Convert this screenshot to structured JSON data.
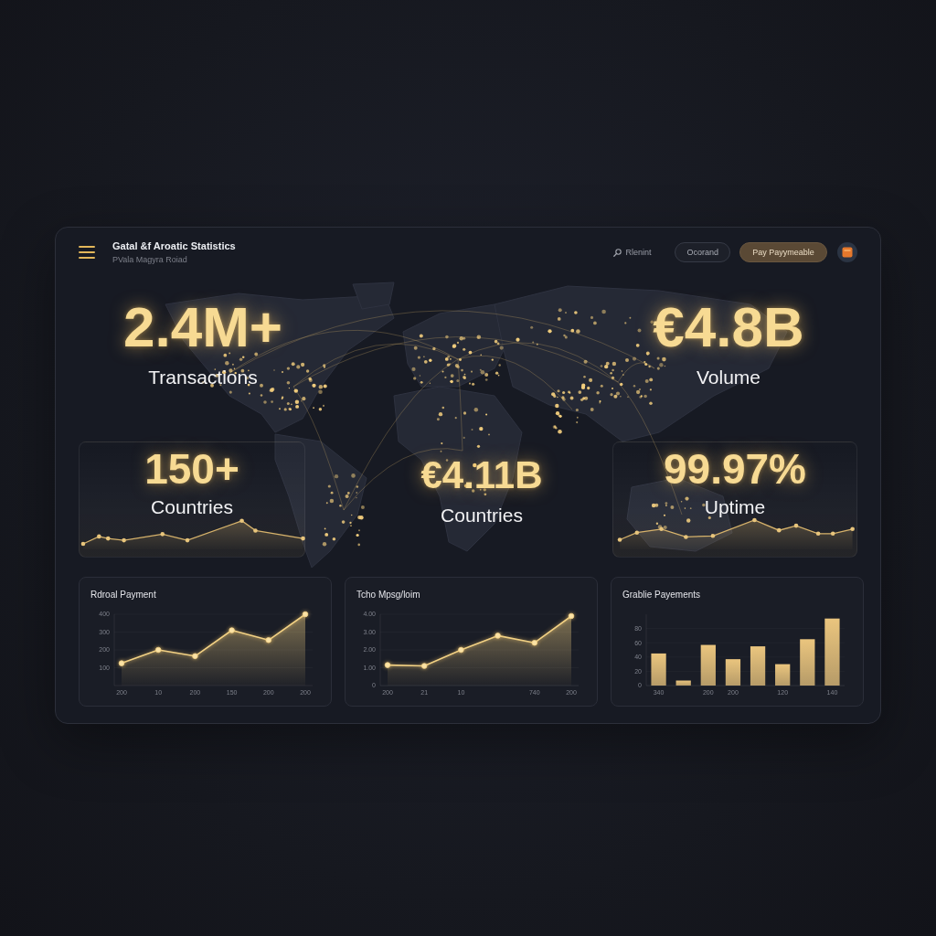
{
  "header": {
    "title": "Gatal &f Aroatic Statistics",
    "subtitle": "PVala Magyra Roiad",
    "search_link": "Rlenint",
    "buttons": [
      {
        "label": "Ocorand",
        "kind": "outline"
      },
      {
        "label": "Pay Payymeable",
        "kind": "primary"
      }
    ]
  },
  "hero": {
    "top_stats": [
      {
        "value": "2.4M+",
        "label": "Transactions"
      },
      {
        "value": "€4.8B",
        "label": "Volume"
      }
    ],
    "bottom_stats": [
      {
        "value": "150+",
        "label": "Countries",
        "kind": "panel"
      },
      {
        "value": "€4.11B",
        "label": "Countries",
        "kind": "plain"
      },
      {
        "value": "99.97%",
        "label": "Uptime",
        "kind": "panel"
      }
    ]
  },
  "charts": [
    {
      "title": "Rdroal Payment",
      "chart_data": {
        "type": "area",
        "categories": [
          "200",
          "10",
          "200",
          "150",
          "200",
          "200"
        ],
        "series": [
          {
            "color": "#f2d184",
            "values": [
              125,
              200,
              165,
              310,
              255,
              400
            ]
          }
        ],
        "ylim": [
          0,
          400
        ],
        "yticks": [
          100,
          200,
          300,
          400
        ]
      }
    },
    {
      "title": "Tcho Mpsg/loim",
      "chart_data": {
        "type": "area",
        "categories": [
          "200",
          "21",
          "10",
          null,
          "740",
          "200"
        ],
        "series": [
          {
            "color": "#f2d184",
            "values": [
              1.15,
              1.1,
              2,
              2.8,
              2.4,
              3.9
            ]
          }
        ],
        "ylim": [
          0,
          4
        ],
        "yticks": [
          {
            "value": 0,
            "label": "0"
          },
          {
            "value": 1,
            "label": "1.00"
          },
          {
            "value": 2,
            "label": "2.00"
          },
          {
            "value": 3,
            "label": "3.00"
          },
          {
            "value": 4,
            "label": "4.00"
          }
        ]
      }
    },
    {
      "title": "Grablie Payements",
      "chart_data": {
        "type": "bar",
        "categories": [
          "340",
          null,
          "200",
          "200",
          null,
          "120",
          null,
          "140"
        ],
        "series": [
          {
            "color": "#eac57e",
            "values": [
              45,
              7,
              57,
              37,
              55,
              30,
              65,
              94
            ]
          }
        ],
        "ylim": [
          0,
          100
        ],
        "yticks": [
          0,
          20,
          40,
          60,
          80
        ]
      }
    }
  ]
}
